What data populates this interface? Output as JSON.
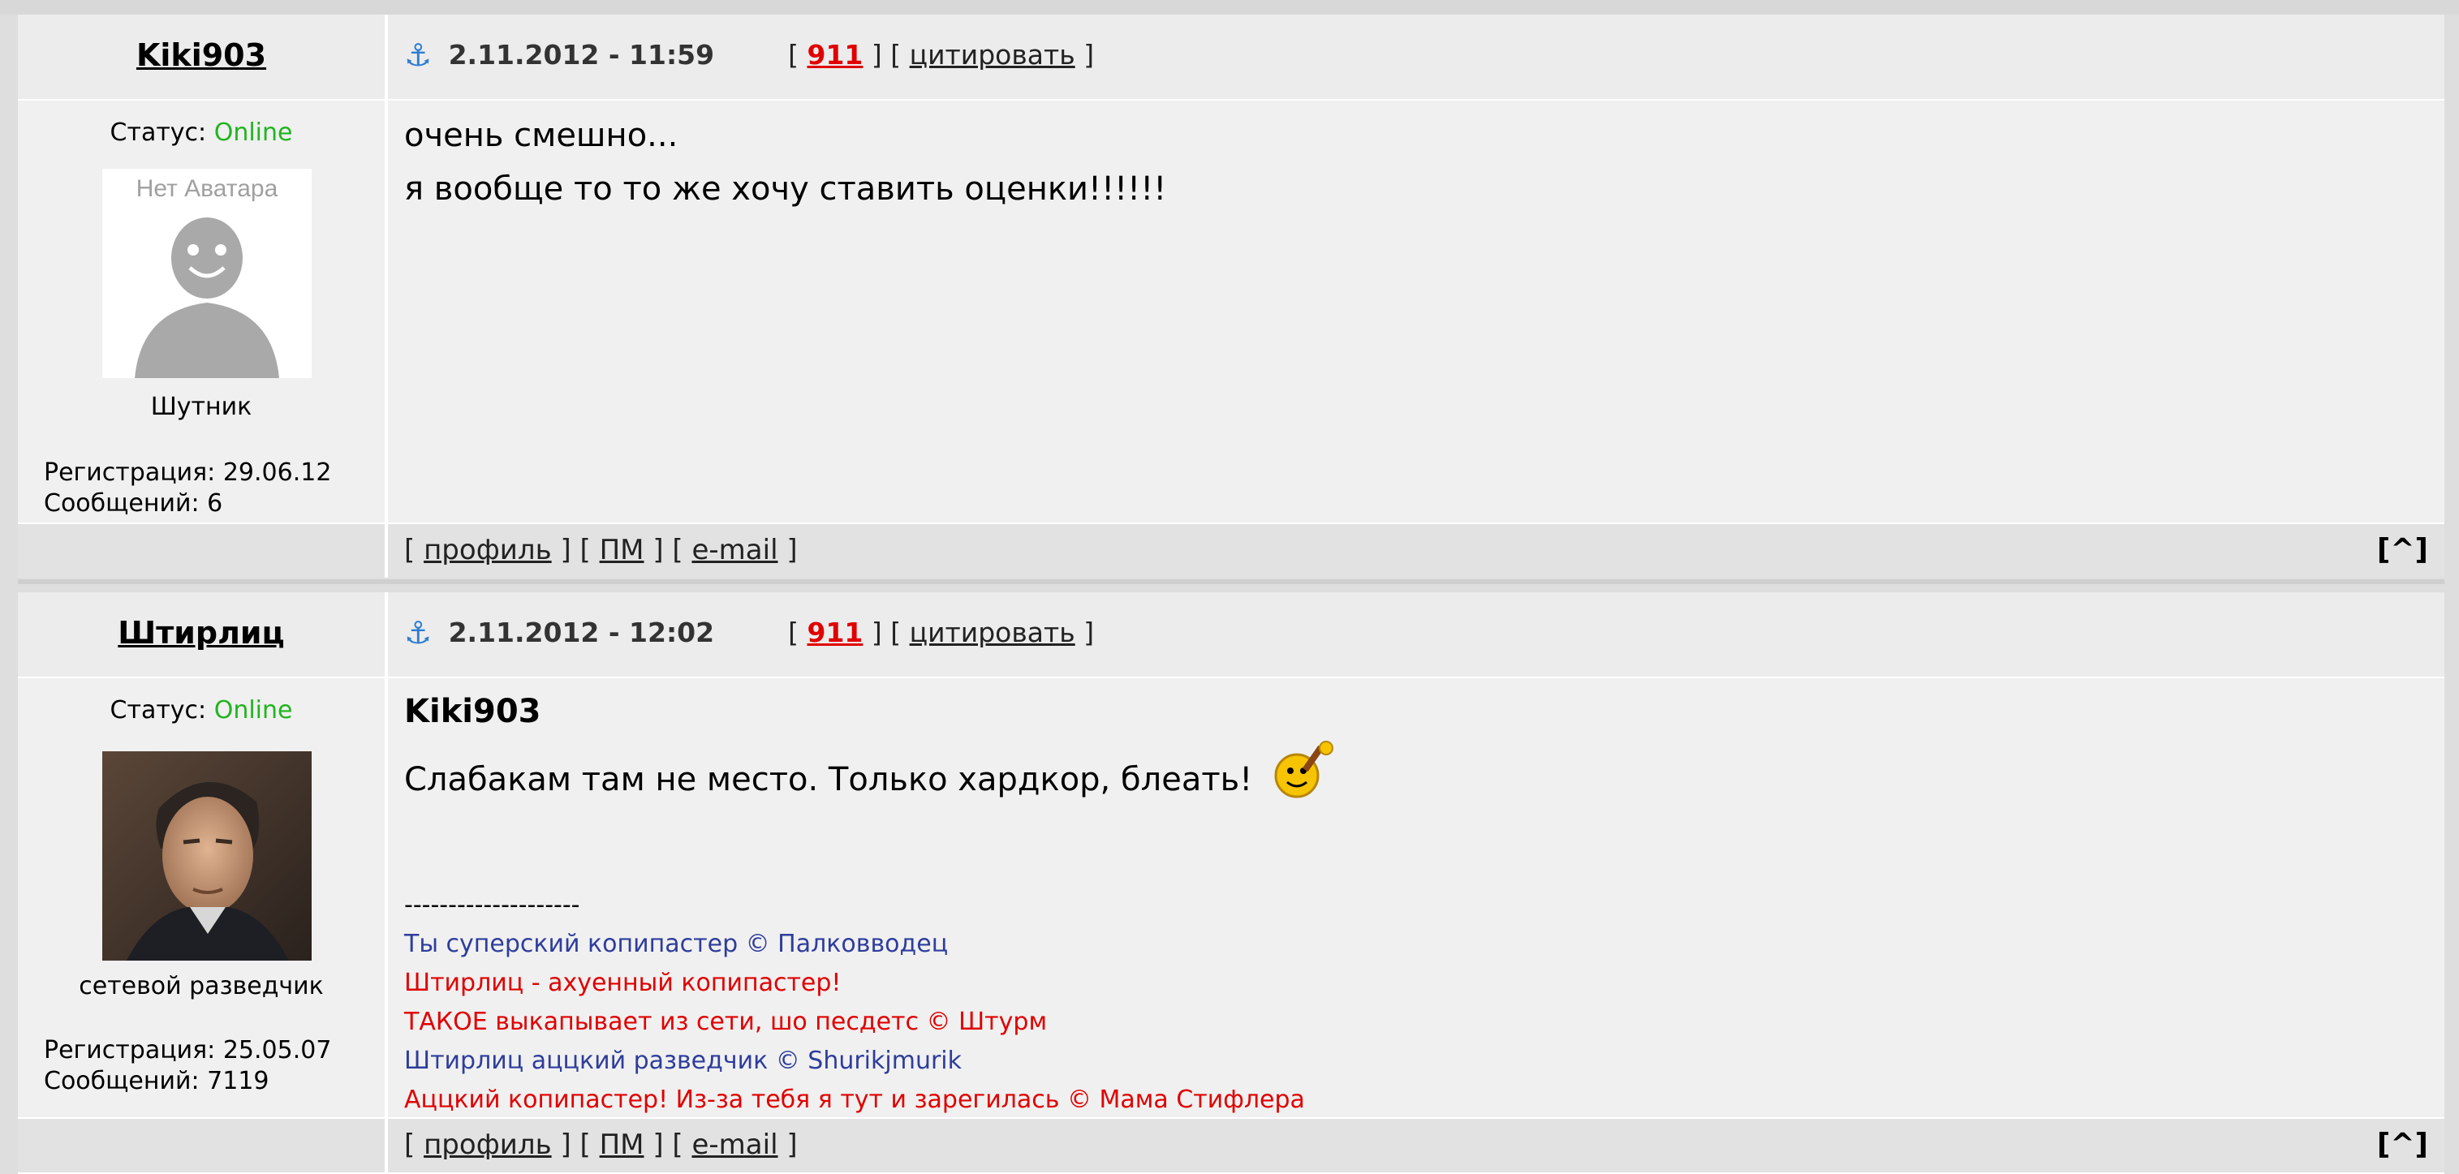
{
  "labels": {
    "status": "Статус:",
    "online": "Online",
    "registration": "Регистрация:",
    "messages": "Сообщений:",
    "quote": "цитировать",
    "profile": "профиль",
    "pm": "ПМ",
    "email": "e-mail",
    "to_top": "[^]",
    "bl": "[",
    "br": "]"
  },
  "posts": [
    {
      "author": "Kiki903",
      "date": "2.11.2012 - 11:59",
      "num": "911",
      "avatar_text": "Нет Аватара",
      "rank": "Шутник",
      "reg_date": "29.06.12",
      "msg_count": "6",
      "lines": [
        "очень смешно...",
        "я вообще то то же хочу ставить оценки!!!!!!"
      ]
    },
    {
      "author": "Штирлиц",
      "date": "2.11.2012 - 12:02",
      "num": "911",
      "rank": "сетевой разведчик",
      "reg_date": "25.05.07",
      "msg_count": "7119",
      "quote_author": "Kiki903",
      "lines": [
        "Слабакам там не место. Только хардкор, блеать!"
      ],
      "sig_sep": "--------------------",
      "signature": [
        {
          "text": "Ты суперский копипастер © Палковводец",
          "color": "#2e3d9c"
        },
        {
          "text": "Штирлиц - ахуенный копипастер!",
          "color": "#e00000"
        },
        {
          "text": "ТАКОЕ выкапывает из сети, шо песдетс © Штурм",
          "color": "#e00000"
        },
        {
          "text": "Штирлиц аццкий разведчик © Shurikjmurik",
          "color": "#2e3d9c"
        },
        {
          "text": "Аццкий копипастер! Из-за тебя я тут и зарегилась © Мама Стифлера",
          "color": "#e00000"
        }
      ]
    }
  ]
}
